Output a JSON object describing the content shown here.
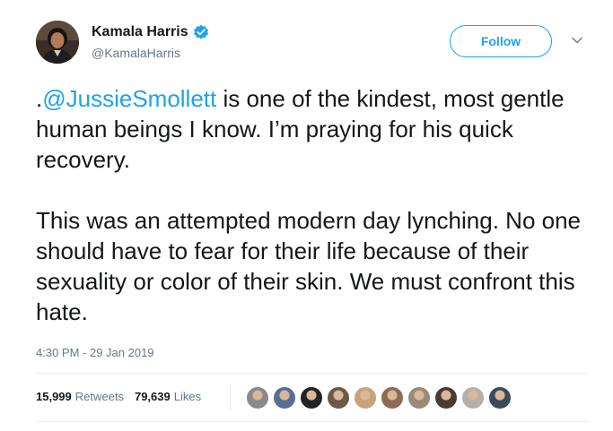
{
  "author": {
    "display_name": "Kamala Harris",
    "handle": "@KamalaHarris",
    "verified": true,
    "avatar_icon": "profile-photo"
  },
  "actions": {
    "follow_label": "Follow",
    "more_icon": "chevron-down-icon"
  },
  "tweet": {
    "paragraph1_prefix": ".",
    "mention": "@JussieSmollett",
    "paragraph1_rest": " is one of the kindest, most gentle human beings I know. I’m praying for his quick recovery.",
    "paragraph2": "This was an attempted modern day lynching. No one should have to fear for their life because of their sexuality or color of their skin. We must confront this hate.",
    "timestamp": "4:30 PM - 29 Jan 2019"
  },
  "stats": {
    "retweets_count": "15,999",
    "retweets_label": "Retweets",
    "likes_count": "79,639",
    "likes_label": "Likes"
  },
  "colors": {
    "accent": "#1da1f2",
    "text": "#14171a",
    "muted": "#657786",
    "divider": "#e6ecf0"
  },
  "likers": [
    {
      "color": "#8a8a8a"
    },
    {
      "color": "#5a6f8f"
    },
    {
      "color": "#222222"
    },
    {
      "color": "#6b5a4a"
    },
    {
      "color": "#c9a27a"
    },
    {
      "color": "#8b6b52"
    },
    {
      "color": "#9a8a7a"
    },
    {
      "color": "#4a3a35"
    },
    {
      "color": "#b8b0a8"
    },
    {
      "color": "#3a4a5a"
    }
  ]
}
